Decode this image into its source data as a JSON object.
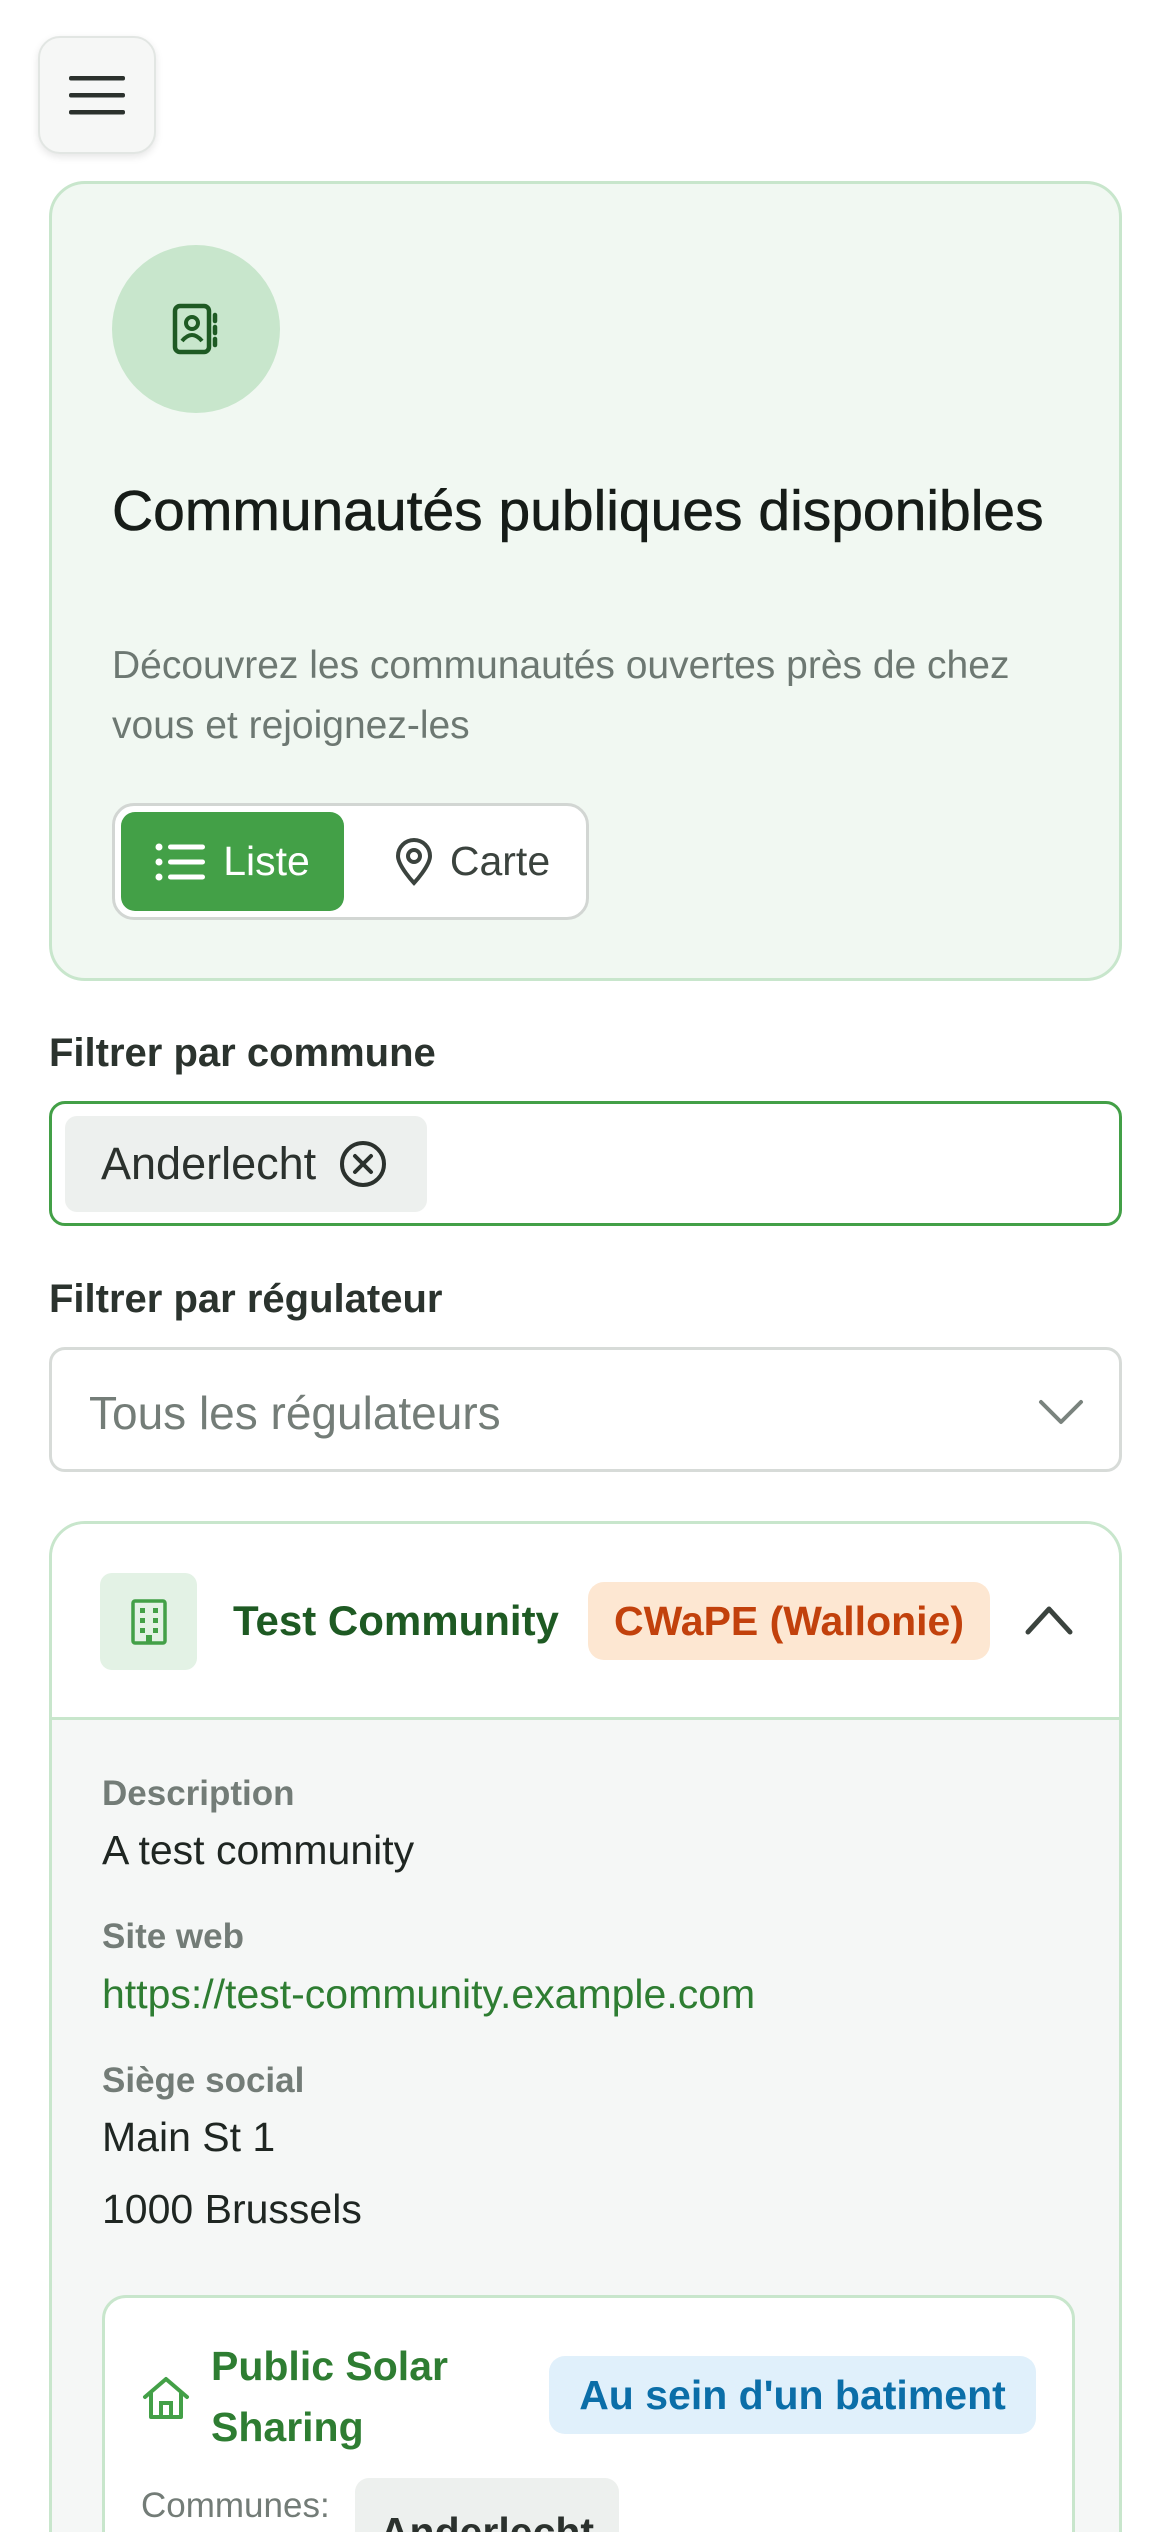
{
  "menu": {
    "icon": "hamburger-menu-icon"
  },
  "hero": {
    "icon": "contact-book-icon",
    "title": "Communautés publiques disponibles",
    "subtitle": "Découvrez les communautés ouvertes près de chez vous et rejoignez-les",
    "view_toggle": {
      "list_label": "Liste",
      "map_label": "Carte",
      "selected": "Liste"
    }
  },
  "filters": {
    "commune_label": "Filtrer par commune",
    "commune_selected": [
      "Anderlecht"
    ],
    "regulator_label": "Filtrer par régulateur",
    "regulator_placeholder": "Tous les régulateurs"
  },
  "community": {
    "name": "Test Community",
    "regulator_badge": "CWaPE (Wallonie)",
    "expanded": true,
    "description_label": "Description",
    "description": "A test community",
    "website_label": "Site web",
    "website": "https://test-community.example.com",
    "hq_label": "Siège social",
    "hq_street": "Main St 1",
    "hq_city": "1000 Brussels",
    "project": {
      "name": "Public Solar Sharing",
      "type_badge": "Au sein d'un batiment",
      "communes_label": "Communes:",
      "communes": [
        "Anderlecht"
      ]
    }
  },
  "colors": {
    "accent_green": "#43a047",
    "dark_green": "#1e5a23",
    "card_border": "#c8e6cc",
    "badge_orange_bg": "#fde7d2",
    "badge_orange_fg": "#c2410c",
    "badge_blue_bg": "#e0f0fb",
    "badge_blue_fg": "#0b6ea8"
  }
}
